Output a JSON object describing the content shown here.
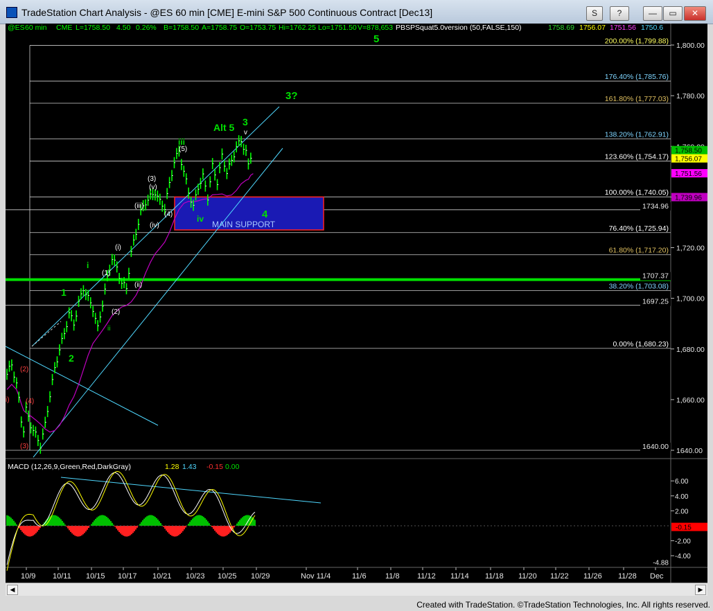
{
  "window": {
    "title": "TradeStation Chart Analysis - @ES 60 min [CME] E-mini S&P 500 Continuous Contract [Dec13]",
    "buttons": {
      "s": "S",
      "q": "?",
      "min": "—",
      "max": "▭",
      "close": "✕"
    }
  },
  "header": {
    "symbol": "@ES",
    "interval": "60 min",
    "exchange": "CME",
    "last": "L=1758.50",
    "change": "4.50",
    "pct": "0.26%",
    "bid": "B=1758.50",
    "ask": "A=1758.75",
    "open": "O=1753.75",
    "high": "Hi=1762.25",
    "low": "Lo=1751.50",
    "volume": "V=878,653",
    "indicator": "PBSPSquat5.0version (50,FALSE,150)",
    "ind_values": [
      "1758.69",
      "1756.07",
      "1751.56",
      "1750.6"
    ]
  },
  "colors": {
    "price_up": "#00ff00",
    "fib_line": "#ffffff",
    "support_box": "#1a1ab4",
    "support_border": "#ff2020",
    "ma": "#c000c0",
    "channel": "#4fd8ff"
  },
  "chart_data": {
    "type": "line",
    "title": "@ES 60 min [CME] E-mini S&P 500 Continuous Contract [Dec13]",
    "price_axis": {
      "ylim": [
        1635,
        1811
      ],
      "ticks": [
        1640,
        1660,
        1680,
        1700,
        1720,
        1740,
        1760,
        1780,
        1800
      ],
      "tick_labels": [
        "1640.00",
        "1,660.00",
        "1,680.00",
        "1,700.00",
        "1,720.00",
        "1,740.00",
        "1,760.00",
        "1,780.00",
        "1,800.00"
      ]
    },
    "date_axis": [
      "10/9",
      "10/11",
      "10/15",
      "10/17",
      "10/21",
      "10/23",
      "10/25",
      "10/29",
      "Nov 11/4",
      "11/6",
      "11/8",
      "11/12",
      "11/14",
      "11/18",
      "11/20",
      "11/22",
      "11/26",
      "11/28",
      "Dec"
    ],
    "price_series": [
      [
        0,
        1670
      ],
      [
        2,
        1674
      ],
      [
        4,
        1666
      ],
      [
        5,
        1660
      ],
      [
        6,
        1652
      ],
      [
        7,
        1648
      ],
      [
        8,
        1656
      ],
      [
        10,
        1650
      ],
      [
        12,
        1646
      ],
      [
        14,
        1642
      ],
      [
        16,
        1650
      ],
      [
        18,
        1662
      ],
      [
        20,
        1672
      ],
      [
        22,
        1680
      ],
      [
        24,
        1686
      ],
      [
        26,
        1694
      ],
      [
        28,
        1690
      ],
      [
        30,
        1698
      ],
      [
        32,
        1704
      ],
      [
        34,
        1700
      ],
      [
        36,
        1696
      ],
      [
        38,
        1688
      ],
      [
        40,
        1698
      ],
      [
        42,
        1708
      ],
      [
        44,
        1716
      ],
      [
        46,
        1712
      ],
      [
        48,
        1706
      ],
      [
        50,
        1704
      ],
      [
        52,
        1718
      ],
      [
        54,
        1726
      ],
      [
        56,
        1734
      ],
      [
        58,
        1738
      ],
      [
        60,
        1740
      ],
      [
        62,
        1742
      ],
      [
        64,
        1738
      ],
      [
        66,
        1736
      ],
      [
        68,
        1745
      ],
      [
        70,
        1754
      ],
      [
        72,
        1758
      ],
      [
        74,
        1750
      ],
      [
        76,
        1742
      ],
      [
        78,
        1736
      ],
      [
        80,
        1744
      ],
      [
        82,
        1748
      ],
      [
        84,
        1740
      ],
      [
        86,
        1752
      ],
      [
        88,
        1746
      ],
      [
        90,
        1756
      ],
      [
        92,
        1750
      ],
      [
        94,
        1754
      ],
      [
        96,
        1760
      ],
      [
        98,
        1762
      ],
      [
        100,
        1758
      ],
      [
        101,
        1752
      ],
      [
        102,
        1756
      ],
      [
        103,
        1758.5
      ]
    ],
    "fib_levels": [
      {
        "price": 1799.88,
        "label": "200.00% (1,799.88)"
      },
      {
        "price": 1785.76,
        "label": "176.40% (1,785.76)"
      },
      {
        "price": 1777.03,
        "label": "161.80% (1,777.03)"
      },
      {
        "price": 1762.91,
        "label": "138.20% (1,762.91)"
      },
      {
        "price": 1754.17,
        "label": "123.60% (1,754.17)"
      },
      {
        "price": 1740.05,
        "label": "100.00% (1,740.05)"
      },
      {
        "price": 1725.94,
        "label": "76.40% (1,725.94)"
      },
      {
        "price": 1717.2,
        "label": "61.80% (1,717.20)"
      },
      {
        "price": 1703.08,
        "label": "38.20% (1,703.08)"
      },
      {
        "price": 1680.23,
        "label": "0.00% (1,680.23)"
      }
    ],
    "price_lines": [
      {
        "price": 1734.96,
        "label": "1734.96"
      },
      {
        "price": 1707.37,
        "label": "1707.37"
      },
      {
        "price": 1697.25,
        "label": "1697.25"
      },
      {
        "price": 1640.0,
        "label": "1640.00"
      }
    ],
    "axis_badges": [
      {
        "price": 1758.5,
        "label": "1,758.50",
        "color": "#00c000"
      },
      {
        "price": 1756.07,
        "label": "1,756.07",
        "color": "#ffff00"
      },
      {
        "price": 1751.56,
        "label": "1,751.56",
        "color": "#ff00ff"
      },
      {
        "price": 1739.96,
        "label": "1,739.96",
        "color": "#c000c0"
      }
    ],
    "support_zone": {
      "label": "MAIN SUPPORT",
      "price_top": 1740,
      "price_bottom": 1727
    },
    "annotations": [
      "5",
      "3?",
      "Alt 5",
      "3",
      "v",
      "iii",
      "(5)",
      "(3)",
      "(v)",
      "(iii)",
      "(iv)",
      "(4)",
      "iv",
      "4",
      "(i)",
      "(ii)",
      "i",
      "(1)",
      "(2)",
      "ii",
      "1",
      "2",
      "(2)",
      "(3)",
      "(4)",
      "i)"
    ],
    "macd": {
      "label": "MACD (12,26,9,Green,Red,DarkGray)",
      "values": [
        "1.28",
        "1.43",
        "-0.15",
        "0.00"
      ],
      "ylim": [
        -5.5,
        8
      ],
      "ticks": [
        "6.00",
        "4.00",
        "2.00",
        "-2.00",
        "-4.00"
      ],
      "tick_values": [
        6,
        4,
        2,
        -2,
        -4
      ],
      "badge": "-0.15",
      "min_label": "-4.88",
      "min_value": -4.88
    }
  },
  "footer": {
    "credit": "Created with TradeStation. ©TradeStation Technologies, Inc. All rights reserved."
  }
}
